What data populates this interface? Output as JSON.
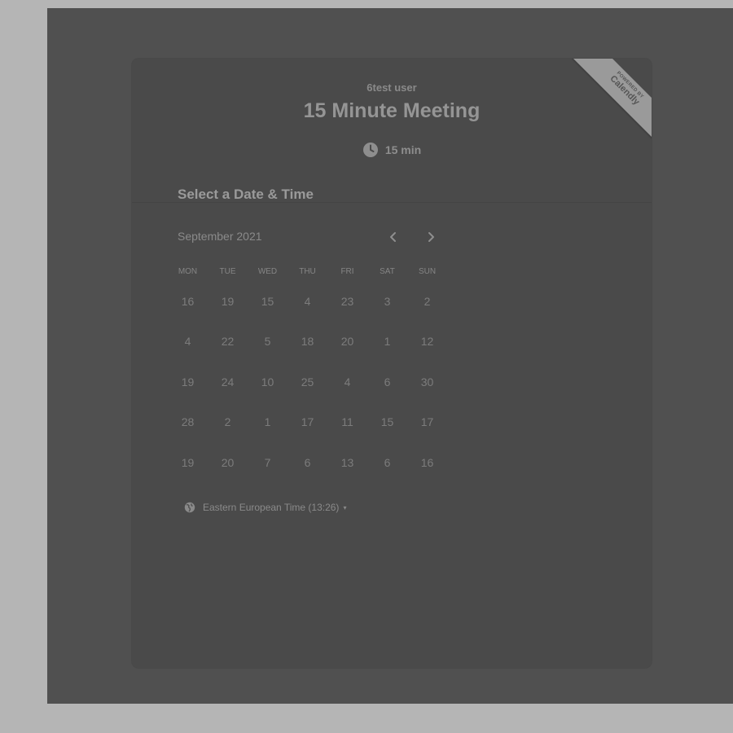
{
  "header": {
    "host_name": "6test user",
    "event_title": "15 Minute Meeting",
    "duration": "15 min",
    "duration_icon": "clock-icon"
  },
  "ribbon": {
    "small_text": "POWERED BY",
    "brand": "Calendly"
  },
  "calendar": {
    "section_title": "Select a Date & Time",
    "month_label": "September 2021",
    "prev_icon": "chevron-left-icon",
    "next_icon": "chevron-right-icon",
    "weekdays": [
      "MON",
      "TUE",
      "WED",
      "THU",
      "FRI",
      "SAT",
      "SUN"
    ],
    "days": [
      "16",
      "19",
      "15",
      "4",
      "23",
      "3",
      "2",
      "4",
      "22",
      "5",
      "18",
      "20",
      "1",
      "12",
      "19",
      "24",
      "10",
      "25",
      "4",
      "6",
      "30",
      "28",
      "2",
      "1",
      "17",
      "11",
      "15",
      "17",
      "19",
      "20",
      "7",
      "6",
      "13",
      "6",
      "16"
    ]
  },
  "timezone": {
    "icon": "globe-icon",
    "label": "Eastern European Time (13:26)",
    "caret": "▾"
  },
  "colors": {
    "page_bg": "#b5b5b5",
    "frame_bg": "#505050",
    "card_bg": "#4a4a4a",
    "ribbon_bg": "#9a9a9a"
  }
}
